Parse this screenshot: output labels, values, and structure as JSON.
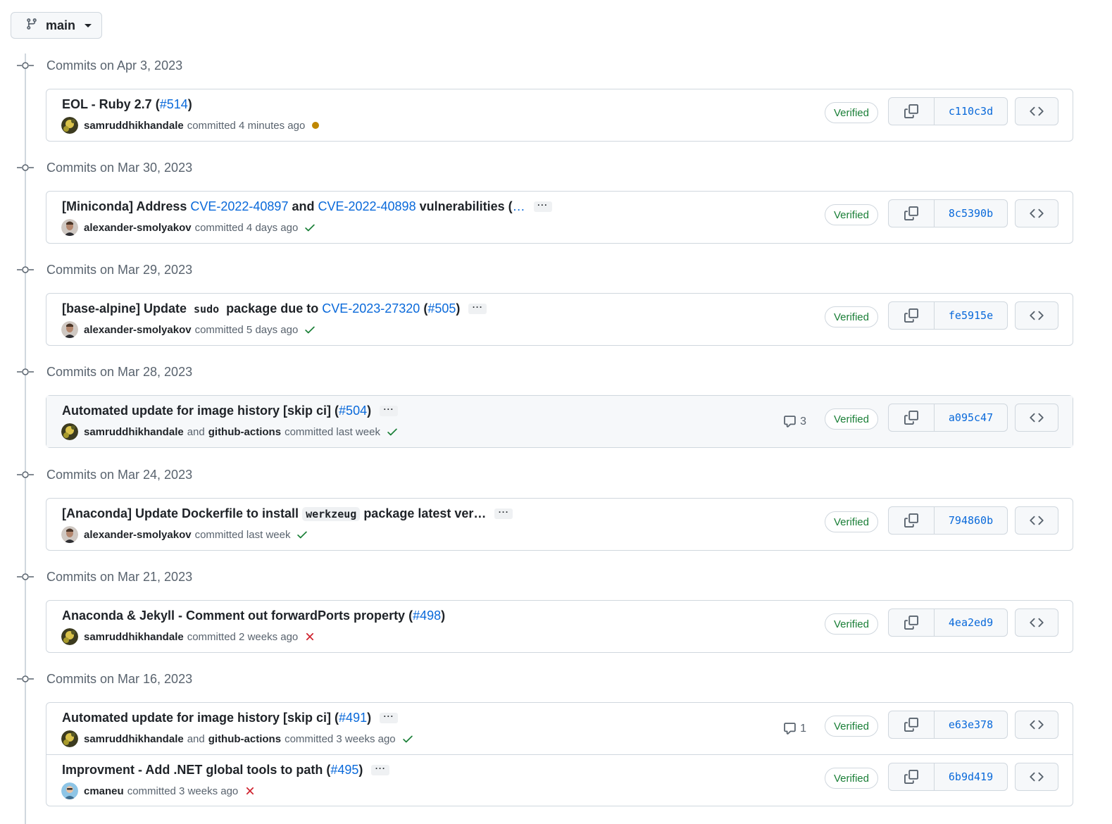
{
  "branch": {
    "label": "main"
  },
  "groups": [
    {
      "date": "Commits on Apr 3, 2023",
      "commits": [
        {
          "title_parts": [
            "EOL - Ruby 2.7 (",
            "#514",
            ")"
          ],
          "author": "samruddhikhandale",
          "coauthor": "",
          "joiner": "",
          "time": "committed 4 minutes ago",
          "status": "pending",
          "comments": "",
          "verified": "Verified",
          "sha": "c110c3d",
          "has_ellipsis": false,
          "highlight": false
        }
      ]
    },
    {
      "date": "Commits on Mar 30, 2023",
      "commits": [
        {
          "title_parts": [
            "[Miniconda] Address ",
            "CVE-2022-40897",
            " and ",
            "CVE-2022-40898",
            " vulnerabilities (",
            "…"
          ],
          "author": "alexander-smolyakov",
          "coauthor": "",
          "joiner": "",
          "time": "committed 4 days ago",
          "status": "success",
          "comments": "",
          "verified": "Verified",
          "sha": "8c5390b",
          "has_ellipsis": true,
          "highlight": false
        }
      ]
    },
    {
      "date": "Commits on Mar 29, 2023",
      "commits": [
        {
          "title_parts": [
            "[base-alpine] Update ",
            "sudo",
            " package due to ",
            "CVE-2023-27320",
            " (",
            "#505",
            ")"
          ],
          "author": "alexander-smolyakov",
          "coauthor": "",
          "joiner": "",
          "time": "committed 5 days ago",
          "status": "success",
          "comments": "",
          "verified": "Verified",
          "sha": "fe5915e",
          "has_ellipsis": true,
          "highlight": false
        }
      ]
    },
    {
      "date": "Commits on Mar 28, 2023",
      "commits": [
        {
          "title_parts": [
            "Automated update for image history [skip ci] (",
            "#504",
            ")"
          ],
          "author": "samruddhikhandale",
          "coauthor": "github-actions",
          "joiner": "and",
          "time": "committed last week",
          "status": "success",
          "comments": "3",
          "verified": "Verified",
          "sha": "a095c47",
          "has_ellipsis": true,
          "highlight": true
        }
      ]
    },
    {
      "date": "Commits on Mar 24, 2023",
      "commits": [
        {
          "title_parts": [
            "[Anaconda] Update Dockerfile to install ",
            "werkzeug",
            " package latest ver…"
          ],
          "author": "alexander-smolyakov",
          "coauthor": "",
          "joiner": "",
          "time": "committed last week",
          "status": "success",
          "comments": "",
          "verified": "Verified",
          "sha": "794860b",
          "has_ellipsis": true,
          "highlight": false
        }
      ]
    },
    {
      "date": "Commits on Mar 21, 2023",
      "commits": [
        {
          "title_parts": [
            "Anaconda & Jekyll - Comment out forwardPorts property (",
            "#498",
            ")"
          ],
          "author": "samruddhikhandale",
          "coauthor": "",
          "joiner": "",
          "time": "committed 2 weeks ago",
          "status": "failure",
          "comments": "",
          "verified": "Verified",
          "sha": "4ea2ed9",
          "has_ellipsis": false,
          "highlight": false
        }
      ]
    },
    {
      "date": "Commits on Mar 16, 2023",
      "commits": [
        {
          "title_parts": [
            "Automated update for image history [skip ci] (",
            "#491",
            ")"
          ],
          "author": "samruddhikhandale",
          "coauthor": "github-actions",
          "joiner": "and",
          "time": "committed 3 weeks ago",
          "status": "success",
          "comments": "1",
          "verified": "Verified",
          "sha": "e63e378",
          "has_ellipsis": true,
          "highlight": false
        },
        {
          "title_parts": [
            "Improvment - Add .NET global tools to path (",
            "#495",
            ")"
          ],
          "author": "cmaneu",
          "coauthor": "",
          "joiner": "",
          "time": "committed 3 weeks ago",
          "status": "failure",
          "comments": "",
          "verified": "Verified",
          "sha": "6b9d419",
          "has_ellipsis": true,
          "highlight": false
        }
      ]
    }
  ],
  "colors": {
    "link": "#0969da",
    "success": "#1a7f37",
    "failure": "#cf222e",
    "pending": "#bf8700",
    "muted": "#59636e",
    "border": "#d0d7de"
  },
  "icons": {
    "branch": "git-branch-icon",
    "node": "commit-node-icon",
    "copy": "copy-icon",
    "browse": "code-icon",
    "comment": "comment-icon",
    "success": "check-icon",
    "failure": "x-icon",
    "pending": "dot-fill-icon"
  }
}
